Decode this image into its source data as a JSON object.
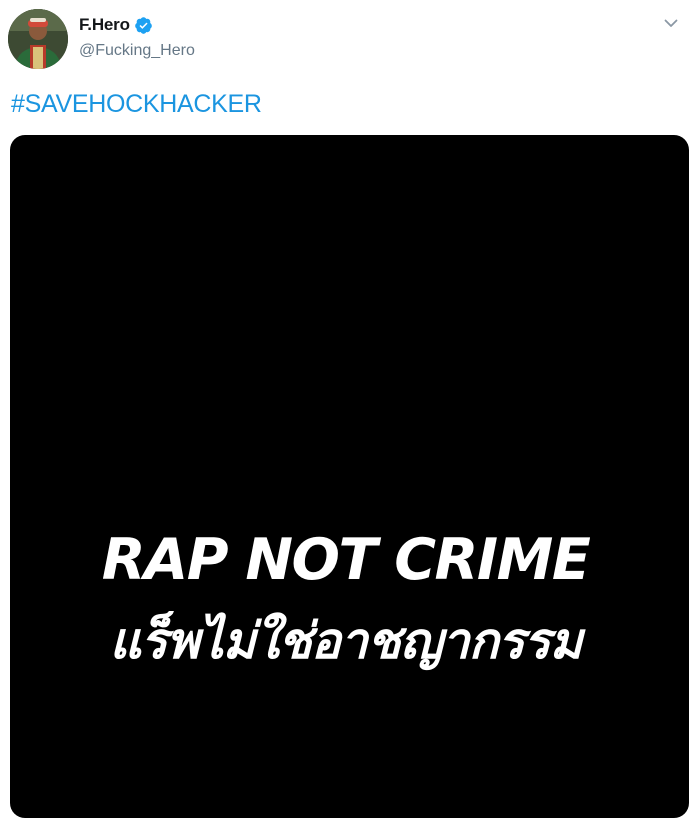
{
  "tweet": {
    "author": {
      "display_name": "F.Hero",
      "handle": "@Fucking_Hero",
      "verified": true,
      "avatar_icon": "user-avatar"
    },
    "text": "#SAVEHOCKHACKER",
    "menu_icon": "chevron-down-icon",
    "media": {
      "background": "#000000",
      "line1": "RAP NOT CRIME",
      "line2": "แร็พไม่ใช่อาชญากรรม"
    }
  },
  "colors": {
    "accent": "#1b95e0",
    "verified_badge": "#1da1f2",
    "name": "#14171a",
    "secondary_text": "#657786"
  }
}
